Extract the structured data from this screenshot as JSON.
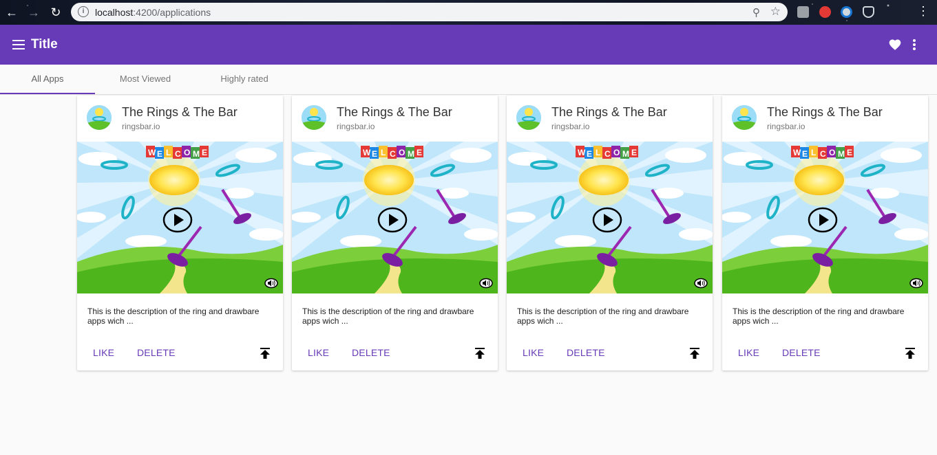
{
  "browser": {
    "url_host": "localhost",
    "url_path": ":4200/applications"
  },
  "toolbar": {
    "title": "Title"
  },
  "tabs": [
    {
      "label": "All Apps",
      "active": true
    },
    {
      "label": "Most Viewed",
      "active": false
    },
    {
      "label": "Highly rated",
      "active": false
    }
  ],
  "cards": [
    {
      "title": "The Rings & The Bar",
      "subtitle": "ringsbar.io",
      "banner": "WELCOME",
      "description": "This is the description of the ring and drawbare apps wich ...",
      "like_label": "LIKE",
      "delete_label": "DELETE"
    },
    {
      "title": "The Rings & The Bar",
      "subtitle": "ringsbar.io",
      "banner": "WELCOME",
      "description": "This is the description of the ring and drawbare apps wich ...",
      "like_label": "LIKE",
      "delete_label": "DELETE"
    },
    {
      "title": "The Rings & The Bar",
      "subtitle": "ringsbar.io",
      "banner": "WELCOME",
      "description": "This is the description of the ring and drawbare apps wich ...",
      "like_label": "LIKE",
      "delete_label": "DELETE"
    },
    {
      "title": "The Rings & The Bar",
      "subtitle": "ringsbar.io",
      "banner": "WELCOME",
      "description": "This is the description of the ring and drawbare apps wich ...",
      "like_label": "LIKE",
      "delete_label": "DELETE"
    }
  ],
  "colors": {
    "primary": "#673ab7",
    "background": "#fafafa"
  },
  "icons": {
    "menu": "menu-icon",
    "favorite": "heart-icon",
    "more": "more-vert-icon",
    "upload": "upload-icon",
    "play": "play-icon",
    "sound": "sound-icon"
  }
}
